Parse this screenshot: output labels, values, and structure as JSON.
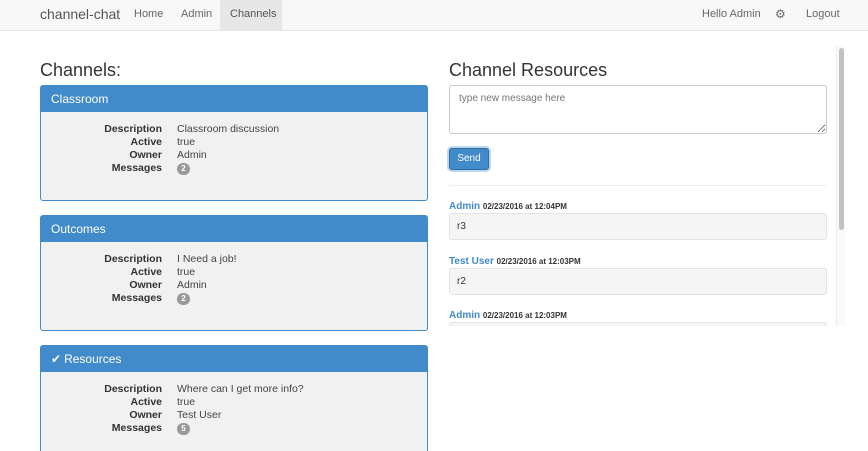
{
  "navbar": {
    "brand": "channel-chat",
    "links": [
      {
        "label": "Home"
      },
      {
        "label": "Admin"
      },
      {
        "label": "Channels"
      }
    ],
    "greeting": "Hello Admin",
    "settings_icon": "gear-icon",
    "logout": "Logout"
  },
  "channels": {
    "heading": "Channels:",
    "labels": {
      "description": "Description",
      "active": "Active",
      "owner": "Owner",
      "messages": "Messages"
    },
    "items": [
      {
        "name": "Classroom",
        "description": "Classroom discussion",
        "active": "true",
        "owner": "Admin",
        "messages": "2",
        "selected": false
      },
      {
        "name": "Outcomes",
        "description": "I Need a job!",
        "active": "true",
        "owner": "Admin",
        "messages": "2",
        "selected": false
      },
      {
        "name": "Resources",
        "description": "Where can I get more info?",
        "active": "true",
        "owner": "Test User",
        "messages": "5",
        "selected": true,
        "icon": "check-icon"
      }
    ]
  },
  "resources": {
    "heading": "Channel Resources",
    "input_placeholder": "type new message here",
    "send_label": "Send",
    "messages": [
      {
        "author": "Admin",
        "time": "02/23/2016 at 12:04PM",
        "text": "r3"
      },
      {
        "author": "Test User",
        "time": "02/23/2016 at 12:03PM",
        "text": "r2"
      },
      {
        "author": "Admin",
        "time": "02/23/2016 at 12:03PM",
        "text": ""
      }
    ]
  },
  "colors": {
    "primary": "#428bca",
    "navbar_bg": "#f8f8f8",
    "panel_bg": "#f1f1f1",
    "badge_bg": "#999999"
  }
}
